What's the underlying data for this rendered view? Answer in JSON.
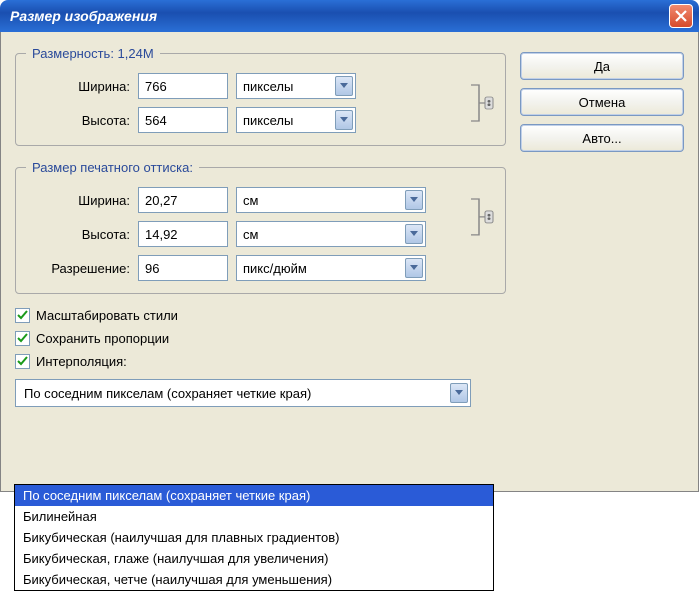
{
  "window": {
    "title": "Размер изображения"
  },
  "groups": {
    "dimensions": {
      "legend": "Размерность:  1,24M",
      "width_label": "Ширина:",
      "width_value": "766",
      "width_unit": "пикселы",
      "height_label": "Высота:",
      "height_value": "564",
      "height_unit": "пикселы"
    },
    "print": {
      "legend": "Размер печатного оттиска:",
      "width_label": "Ширина:",
      "width_value": "20,27",
      "width_unit": "см",
      "height_label": "Высота:",
      "height_value": "14,92",
      "height_unit": "см",
      "resolution_label": "Разрешение:",
      "resolution_value": "96",
      "resolution_unit": "пикс/дюйм"
    }
  },
  "checkboxes": {
    "scale_styles": {
      "label": "Масштабировать стили",
      "checked": true
    },
    "constrain": {
      "label": "Сохранить пропорции",
      "checked": true
    },
    "interpolation": {
      "label": "Интерполяция:",
      "checked": true
    }
  },
  "interpolation_select": {
    "value": "По соседним пикселам (сохраняет четкие края)",
    "options": [
      "По соседним пикселам (сохраняет четкие края)",
      "Билинейная",
      "Бикубическая (наилучшая для плавных градиентов)",
      "Бикубическая, глаже (наилучшая для увеличения)",
      "Бикубическая, четче (наилучшая для уменьшения)"
    ]
  },
  "buttons": {
    "ok": "Да",
    "cancel": "Отмена",
    "auto": "Авто..."
  }
}
